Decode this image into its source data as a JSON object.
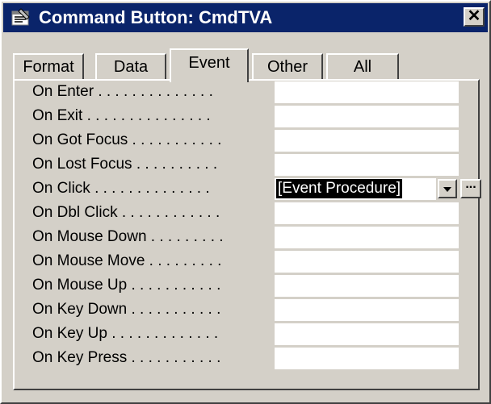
{
  "window": {
    "title": "Command Button: CmdTVA",
    "close_glyph": "✕",
    "icon": "properties-sheet-icon"
  },
  "tabs": [
    {
      "label": "Format",
      "active": false
    },
    {
      "label": "Data",
      "active": false
    },
    {
      "label": "Event",
      "active": true
    },
    {
      "label": "Other",
      "active": false
    },
    {
      "label": "All",
      "active": false
    }
  ],
  "properties": [
    {
      "label": "On Enter . . . . . . . . . . . . . .",
      "value": ""
    },
    {
      "label": "On Exit . . . . . . . . . . . . . . .",
      "value": ""
    },
    {
      "label": "On Got Focus . . . . . . . . . . .",
      "value": ""
    },
    {
      "label": "On Lost Focus . . . . . . . . . .",
      "value": ""
    },
    {
      "label": "On Click . . . . . . . . . . . . . .",
      "value": "[Event Procedure]"
    },
    {
      "label": "On Dbl Click . . . . . . . . . . . .",
      "value": ""
    },
    {
      "label": "On Mouse Down . . . . . . . . .",
      "value": ""
    },
    {
      "label": "On Mouse Move . . . . . . . . .",
      "value": ""
    },
    {
      "label": "On Mouse Up . . . . . . . . . . .",
      "value": ""
    },
    {
      "label": "On Key Down . . . . . . . . . . .",
      "value": ""
    },
    {
      "label": "On Key Up . . . . . . . . . . . . .",
      "value": ""
    },
    {
      "label": "On Key Press . . . . . . . . . . .",
      "value": ""
    }
  ],
  "controls": {
    "dropdown_icon": "dropdown-arrow-icon",
    "build_label": "..."
  },
  "colors": {
    "titlebar": "#0a246a",
    "dialog_face": "#d4d0c8",
    "selection": "#000000"
  }
}
